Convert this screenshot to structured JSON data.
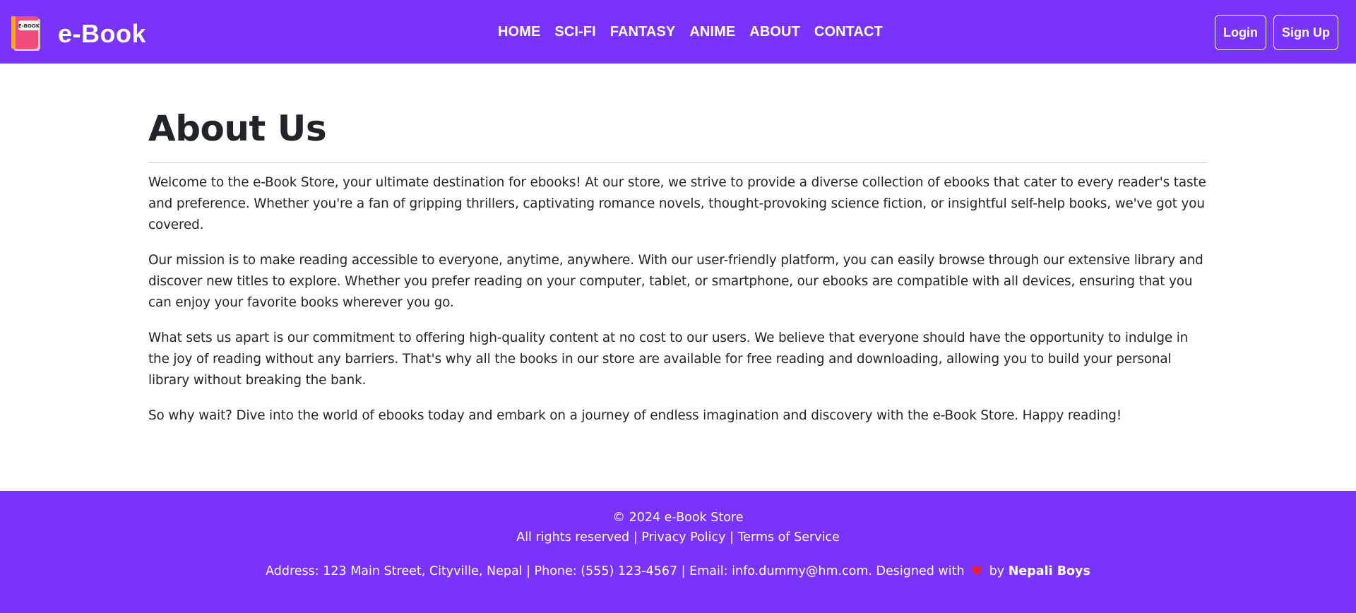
{
  "brand": {
    "name": "e-Book",
    "logo_text": "E-BOOK",
    "logo_icon": "book-icon"
  },
  "nav": {
    "links": [
      "HOME",
      "SCI-FI",
      "FANTASY",
      "ANIME",
      "ABOUT",
      "CONTACT"
    ],
    "login_label": "Login",
    "signup_label": "Sign Up"
  },
  "page": {
    "title": "About Us",
    "paragraphs": [
      "Welcome to the e-Book Store, your ultimate destination for ebooks! At our store, we strive to provide a diverse collection of ebooks that cater to every reader's taste and preference. Whether you're a fan of gripping thrillers, captivating romance novels, thought-provoking science fiction, or insightful self-help books, we've got you covered.",
      "Our mission is to make reading accessible to everyone, anytime, anywhere. With our user-friendly platform, you can easily browse through our extensive library and discover new titles to explore. Whether you prefer reading on your computer, tablet, or smartphone, our ebooks are compatible with all devices, ensuring that you can enjoy your favorite books wherever you go.",
      "What sets us apart is our commitment to offering high-quality content at no cost to our users. We believe that everyone should have the opportunity to indulge in the joy of reading without any barriers. That's why all the books in our store are available for free reading and downloading, allowing you to build your personal library without breaking the bank.",
      "So why wait? Dive into the world of ebooks today and embark on a journey of endless imagination and discovery with the e-Book Store. Happy reading!"
    ]
  },
  "footer": {
    "copyright": "© 2024 e-Book Store",
    "rights": "All rights reserved",
    "separator": "|",
    "privacy": "Privacy Policy",
    "terms": "Terms of Service",
    "contact_line": "Address: 123 Main Street, Cityville, Nepal | Phone: (555) 123-4567 | Email: info.dummy@hm.com. Designed with",
    "by": "by",
    "authors": "Nepali Boys",
    "heart_icon": "heart-icon"
  },
  "colors": {
    "brand_purple": "#7a33fa",
    "text": "#212529",
    "heart": "#e5213b"
  }
}
